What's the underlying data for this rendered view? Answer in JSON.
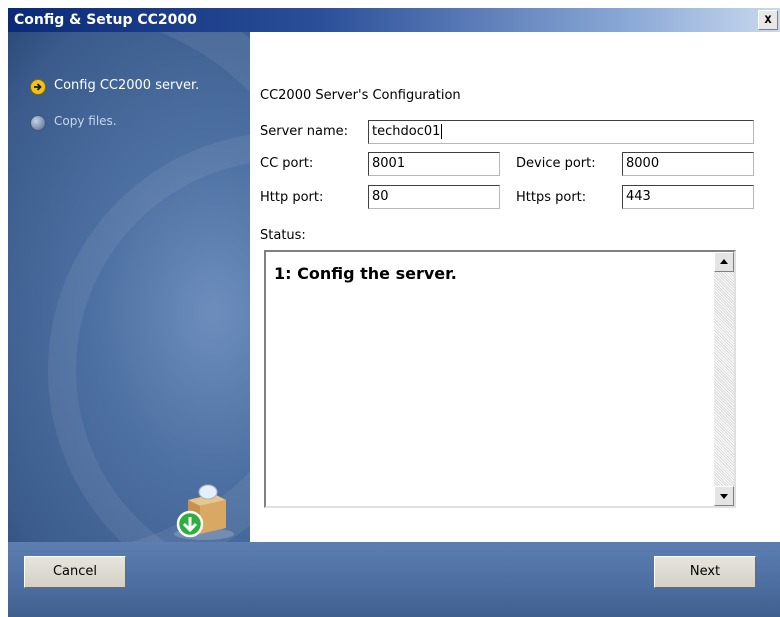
{
  "window": {
    "title": "Config & Setup CC2000",
    "close_label": "x"
  },
  "steps": [
    {
      "label": "Config CC2000 server.",
      "state": "current",
      "icon": "arrow-right-icon"
    },
    {
      "label": "Copy files.",
      "state": "pending",
      "icon": "circle-icon"
    }
  ],
  "config": {
    "heading": "CC2000 Server's Configuration",
    "server_name_label": "Server name:",
    "server_name_value": "techdoc01",
    "cc_port_label": "CC port:",
    "cc_port_value": "8001",
    "device_port_label": "Device port:",
    "device_port_value": "8000",
    "http_port_label": "Http port:",
    "http_port_value": "80",
    "https_port_label": "Https port:",
    "https_port_value": "443",
    "status_label": "Status:",
    "status_text": "1: Config the server."
  },
  "buttons": {
    "cancel": "Cancel",
    "next": "Next"
  },
  "colors": {
    "title_bar": "#0a2a78",
    "sidebar": "#4e71a3",
    "current_step_icon": "#f3c316"
  }
}
